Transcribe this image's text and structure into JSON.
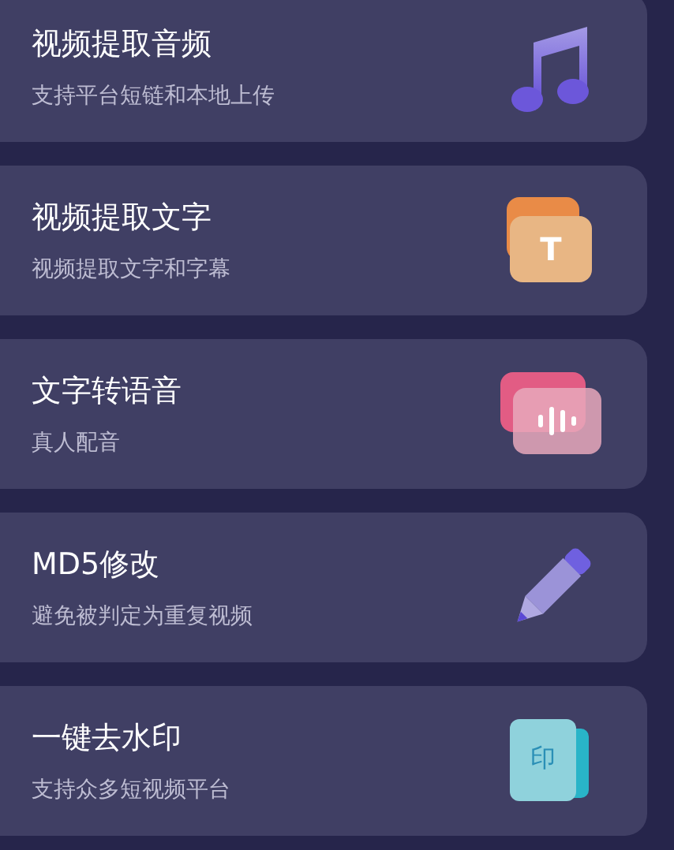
{
  "tools": [
    {
      "title": "视频提取音频",
      "subtitle": "支持平台短链和本地上传",
      "kind": "music"
    },
    {
      "title": "视频提取文字",
      "subtitle": "视频提取文字和字幕",
      "kind": "text",
      "icon_text": "T"
    },
    {
      "title": "文字转语音",
      "subtitle": "真人配音",
      "kind": "voice"
    },
    {
      "title": "MD5修改",
      "subtitle": "避免被判定为重复视频",
      "kind": "pencil"
    },
    {
      "title": "一键去水印",
      "subtitle": "支持众多短视频平台",
      "kind": "stamp",
      "icon_text": "印"
    }
  ]
}
